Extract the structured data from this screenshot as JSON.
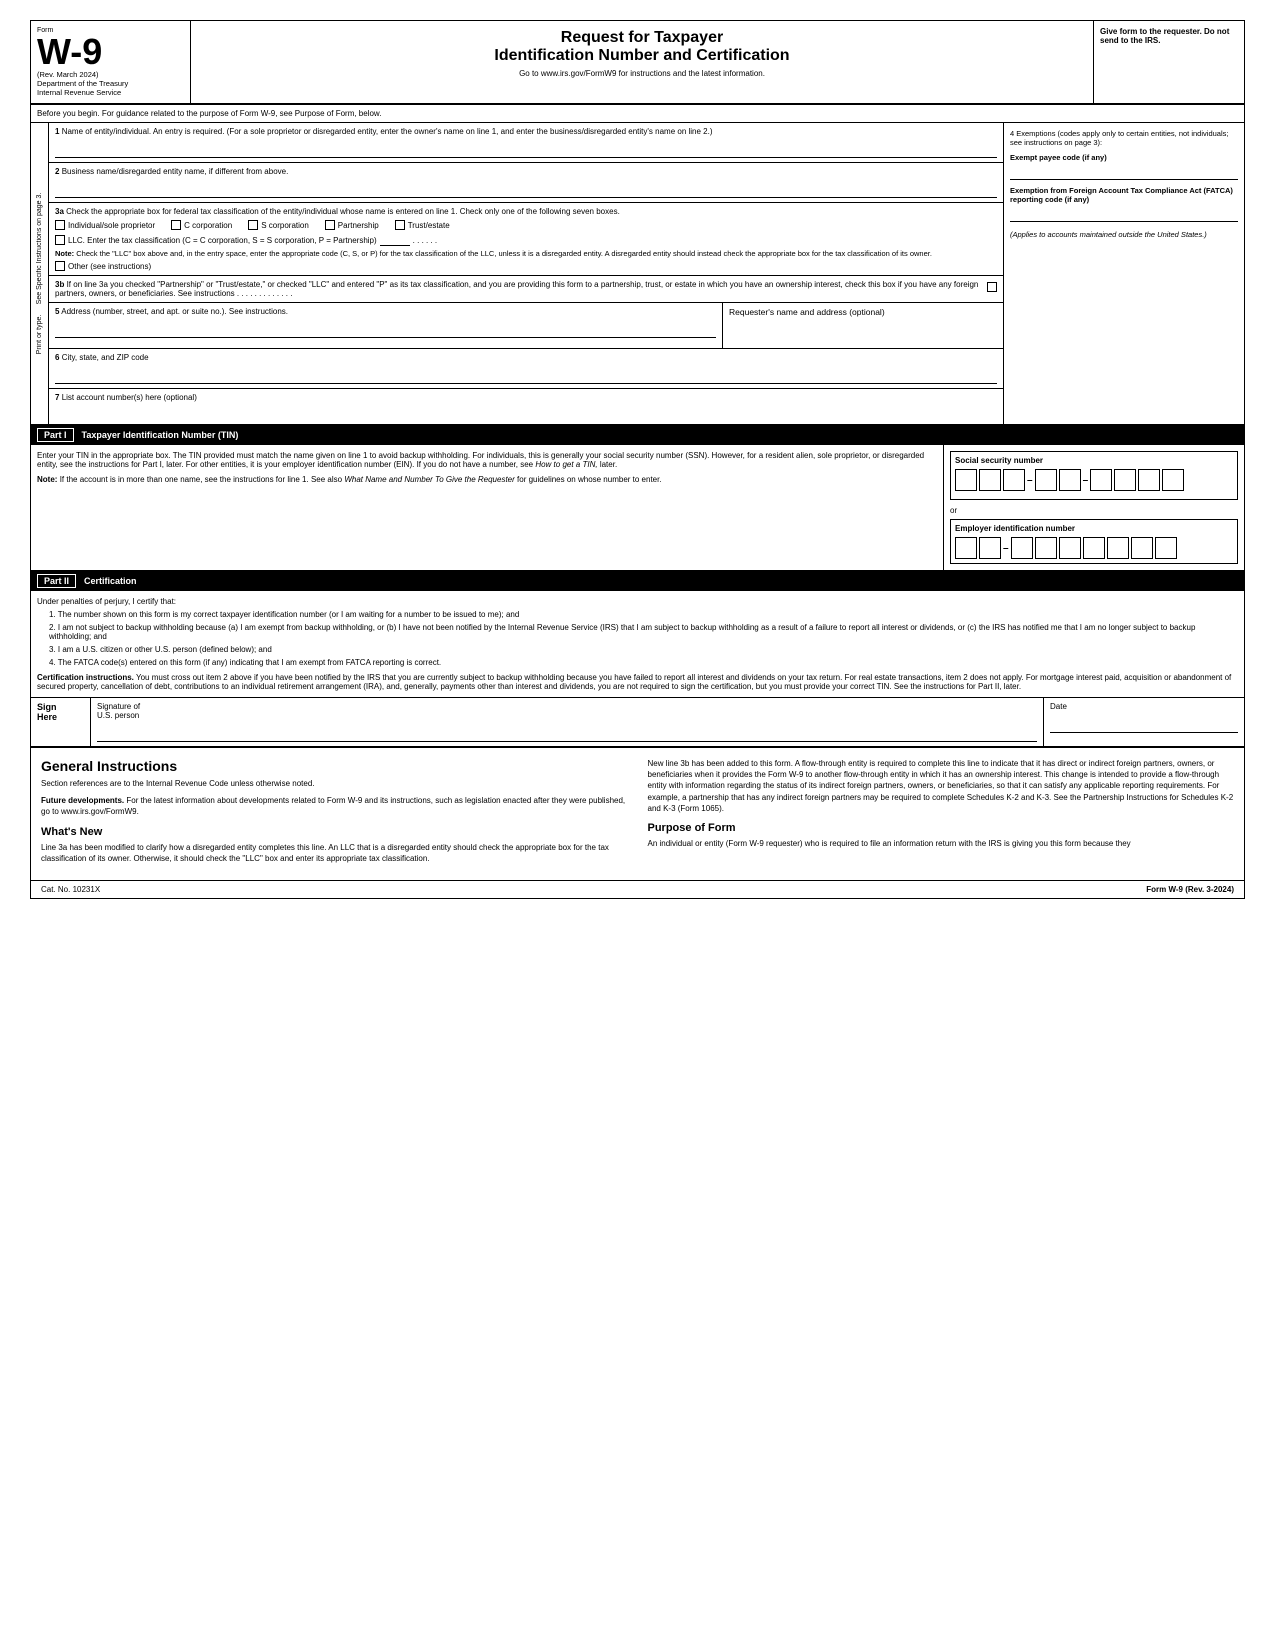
{
  "header": {
    "form_label": "Form",
    "form_number": "W-9",
    "rev_date": "(Rev. March 2024)",
    "dept": "Department of the Treasury",
    "irs": "Internal Revenue Service",
    "title1": "Request for Taxpayer",
    "title2": "Identification Number and Certification",
    "website": "Go to www.irs.gov/FormW9 for instructions and the latest information.",
    "give_form": "Give form to the requester. Do not send to the IRS."
  },
  "before_begin": "Before you begin. For guidance related to the purpose of Form W-9, see Purpose of Form, below.",
  "fields": {
    "f1_label": "1",
    "f1_text": "Name of entity/individual. An entry is required. (For a sole proprietor or disregarded entity, enter the owner's name on line 1, and enter the business/disregarded entity's name on line 2.)",
    "f2_label": "2",
    "f2_text": "Business name/disregarded entity name, if different from above.",
    "f3a_label": "3a",
    "f3a_text": "Check the appropriate box for federal tax classification of the entity/individual whose name is entered on line 1. Check only one of the following seven boxes.",
    "cb_individual": "Individual/sole proprietor",
    "cb_ccorp": "C corporation",
    "cb_scorp": "S corporation",
    "cb_partnership": "Partnership",
    "cb_trust": "Trust/estate",
    "cb_llc": "LLC. Enter the tax classification (C = C corporation, S = S corporation, P = Partnership)",
    "llc_dots": ". . . . . .",
    "note_label": "Note:",
    "note_text": "Check the \"LLC\" box above and, in the entry space, enter the appropriate code (C, S, or P) for the tax classification of the LLC, unless it is a disregarded entity. A disregarded entity should instead check the appropriate box for the tax classification of its owner.",
    "cb_other": "Other (see instructions)",
    "f3b_label": "3b",
    "f3b_text": "If on line 3a you checked \"Partnership\" or \"Trust/estate,\" or checked \"LLC\" and entered \"P\" as its tax classification, and you are providing this form to a partnership, trust, or estate in which you have an ownership interest, check this box if you have any foreign partners, owners, or beneficiaries. See instructions",
    "f5_label": "5",
    "f5_text": "Address (number, street, and apt. or suite no.). See instructions.",
    "f5_right": "Requester's name and address (optional)",
    "f6_label": "6",
    "f6_text": "City, state, and ZIP code",
    "f7_label": "7",
    "f7_text": "List account number(s) here (optional)"
  },
  "sidebar_text": "See Specific Instructions on page 3.",
  "sidebar_print": "Print or type.",
  "exemptions": {
    "title": "4 Exemptions (codes apply only to certain entities, not individuals; see instructions on page 3):",
    "payee_label": "Exempt payee code (if any)",
    "fatca_label": "Exemption from Foreign Account Tax Compliance Act (FATCA) reporting code (if any)",
    "italic_note": "(Applies to accounts maintained outside the United States.)"
  },
  "part1": {
    "label": "Part I",
    "title": "Taxpayer Identification Number (TIN)",
    "body1": "Enter your TIN in the appropriate box. The TIN provided must match the name given on line 1 to avoid backup withholding. For individuals, this is generally your social security number (SSN). However, for a resident alien, sole proprietor, or disregarded entity, see the instructions for Part I, later. For other entities, it is your employer identification number (EIN). If you do not have a number, see",
    "how_to_get": "How to get a",
    "tin": "TIN,",
    "later": "later.",
    "note_label": "Note:",
    "note_text": "If the account is in more than one name, see the instructions for line 1. See also",
    "what_name": "What Name and",
    "number_to_give": "Number To Give the Requester",
    "guidelines": "for guidelines on whose number to enter.",
    "ssn_label": "Social security number",
    "ssn_boxes": [
      "",
      "",
      "",
      "",
      "",
      "",
      "",
      "",
      ""
    ],
    "or_label": "or",
    "ein_label": "Employer identification number",
    "ein_boxes": [
      "",
      "",
      "",
      "",
      "",
      "",
      "",
      "",
      ""
    ]
  },
  "part2": {
    "label": "Part II",
    "title": "Certification",
    "under_penalties": "Under penalties of perjury, I certify that:",
    "cert1": "1. The number shown on this form is my correct taxpayer identification number (or I am waiting for a number to be issued to me); and",
    "cert2": "2. I am not subject to backup withholding because (a) I am exempt from backup withholding, or (b) I have not been notified by the Internal Revenue Service (IRS) that I am subject to backup withholding as a result of a failure to report all interest or dividends, or (c) the IRS has notified me that I am no longer subject to backup withholding; and",
    "cert3": "3. I am a U.S. citizen or other U.S. person (defined below); and",
    "cert4": "4. The FATCA code(s) entered on this form (if any) indicating that I am exempt from FATCA reporting is correct.",
    "cert_instructions_label": "Certification instructions.",
    "cert_instructions_text": "You must cross out item 2 above if you have been notified by the IRS that you are currently subject to backup withholding because you have failed to report all interest and dividends on your tax return. For real estate transactions, item 2 does not apply. For mortgage interest paid, acquisition or abandonment of secured property, cancellation of debt, contributions to an individual retirement arrangement (IRA), and, generally, payments other than interest and dividends, you are not required to sign the certification, but you must provide your correct TIN. See the instructions for Part II, later."
  },
  "sign_here": {
    "label": "Sign\nHere",
    "sig_label": "Signature of",
    "sig_sublabel": "U.S. person",
    "date_label": "Date"
  },
  "general_instructions": {
    "title": "General Instructions",
    "para1": "Section references are to the Internal Revenue Code unless otherwise noted.",
    "para2_label": "Future developments.",
    "para2": "For the latest information about developments related to Form W-9 and its instructions, such as legislation enacted after they were published, go to www.irs.gov/FormW9.",
    "whats_new_title": "What's New",
    "whats_new_para": "Line 3a has been modified to clarify how a disregarded entity completes this line. An LLC that is a disregarded entity should check the appropriate box for the tax classification of its owner. Otherwise, it should check the \"LLC\" box and enter its appropriate tax classification.",
    "right_para1": "New line 3b has been added to this form. A flow-through entity is required to complete this line to indicate that it has direct or indirect foreign partners, owners, or beneficiaries when it provides the Form W-9 to another flow-through entity in which it has an ownership interest. This change is intended to provide a flow-through entity with information regarding the status of its indirect foreign partners, owners, or beneficiaries, so that it can satisfy any applicable reporting requirements. For example, a partnership that has any indirect foreign partners may be required to complete Schedules K-2 and K-3. See the Partnership Instructions for Schedules K-2 and K-3 (Form 1065).",
    "purpose_title": "Purpose of Form",
    "purpose_para": "An individual or entity (Form W-9 requester) who is required to file an information return with the IRS is giving you this form because they"
  },
  "footer": {
    "cat_no": "Cat. No. 10231X",
    "form_ref": "Form W-9 (Rev. 3-2024)"
  }
}
